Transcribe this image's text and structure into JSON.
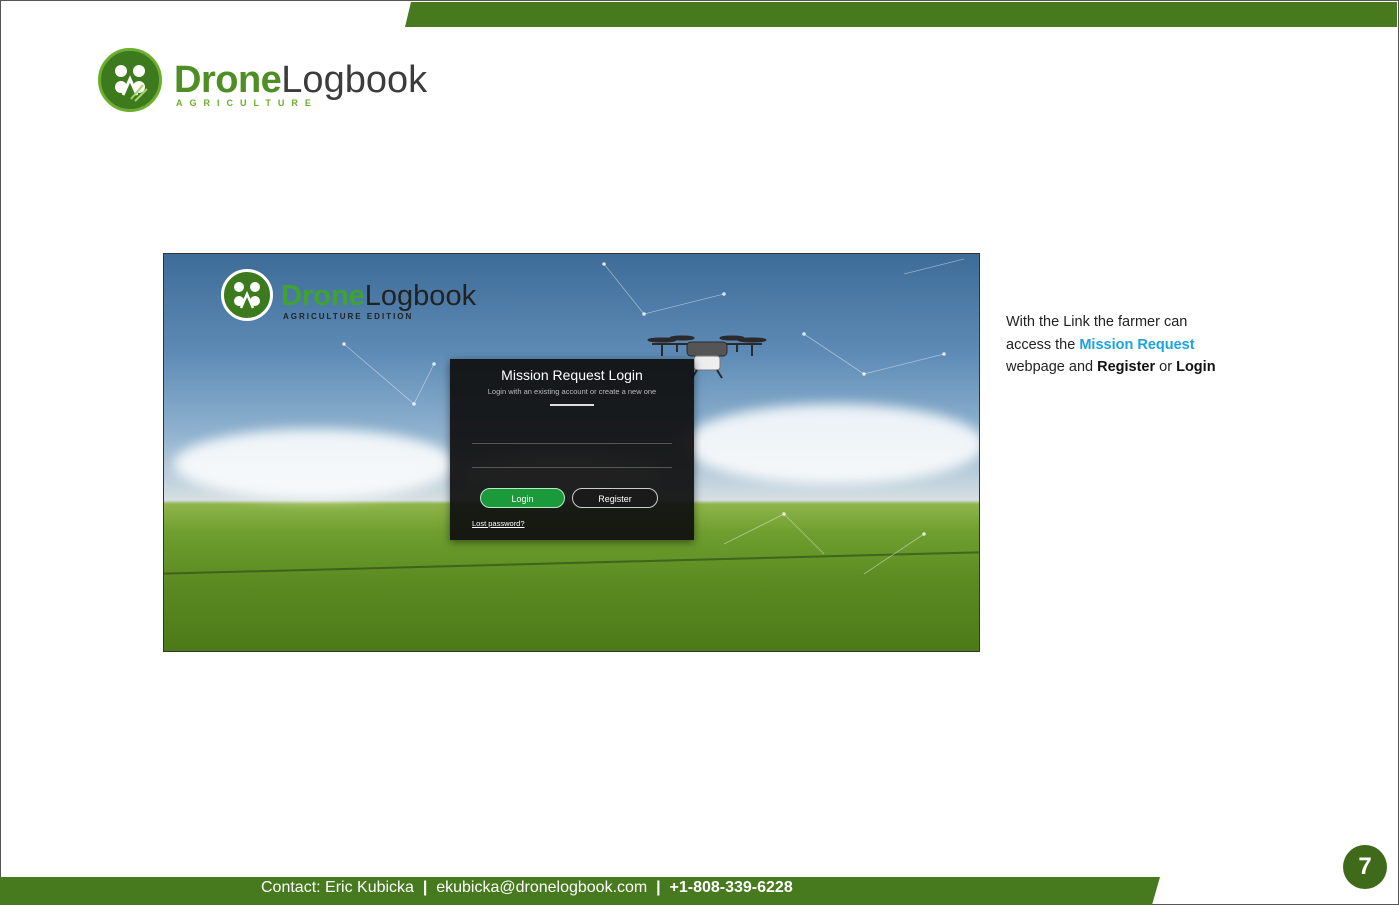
{
  "header": {
    "logo_drone": "Drone",
    "logo_logbook": "Logbook",
    "logo_sub": "AGRICULTURE"
  },
  "screenshot": {
    "logo_drone": "Drone",
    "logo_logbook": "Logbook",
    "logo_sub": "AGRICULTURE EDITION",
    "login": {
      "title": "Mission Request Login",
      "subtitle": "Login with an existing account or create a new one",
      "login_button": "Login",
      "register_button": "Register",
      "lost_password": "Lost password?"
    }
  },
  "side_text": {
    "line1": "With the Link the  farmer can",
    "line2_prefix": "access the ",
    "line2_link": "Mission Request",
    "line3_prefix": "webpage and ",
    "line3_register": "Register",
    "line3_or": " or ",
    "line3_login": "Login"
  },
  "footer": {
    "contact": "Contact: Eric Kubicka",
    "sep1": "  |  ",
    "email": "ekubicka@dronelogbook.com",
    "sep2": "  |  ",
    "phone": "+1-808-339-6228"
  },
  "page_number": "7",
  "colors": {
    "brand_green": "#477a1e",
    "link_blue": "#1aa3e0",
    "button_green": "#1a9a3a"
  }
}
